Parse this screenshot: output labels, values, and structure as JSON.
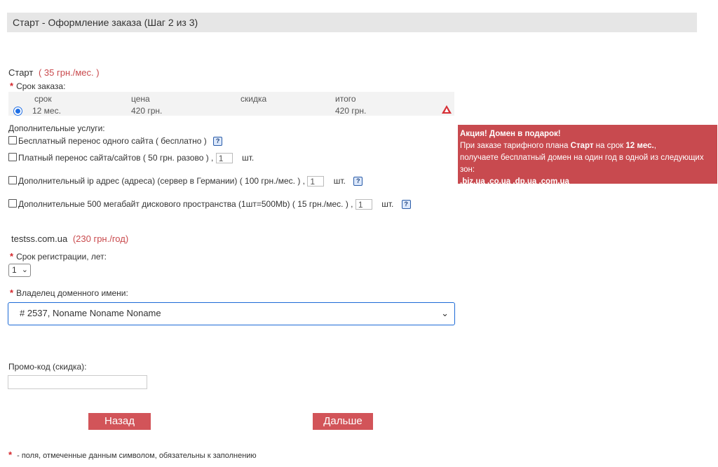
{
  "header": {
    "title": "Старт - Оформление заказа (Шаг 2 из 3)"
  },
  "plan": {
    "name": "Старт",
    "price": "( 35 грн./мес. )",
    "term_label": "Срок заказа:",
    "table": {
      "headers": [
        "срок",
        "цена",
        "скидка",
        "итого"
      ],
      "row": {
        "term": "12 мес.",
        "price": "420 грн.",
        "discount": "",
        "total": "420 грн."
      }
    }
  },
  "extras": {
    "label": "Дополнительные услуги:",
    "items": [
      {
        "text": "Бесплатный перенос одного сайта ( бесплатно )"
      },
      {
        "text": "Платный перенос сайта/сайтов ( 50 грн. разово ) ,",
        "qty": "1",
        "unit": "шт."
      },
      {
        "text": "Дополнительный ip адрес (адреса) (сервер в Германии) ( 100 грн./мес. ) ,",
        "qty": "1",
        "unit": "шт."
      },
      {
        "text": "Дополнительные 500 мегабайт дискового пространства (1шт=500Mb) ( 15 грн./мес. ) ,",
        "qty": "1",
        "unit": "шт."
      }
    ],
    "help_glyph": "?"
  },
  "promo_banner": {
    "title": "Акция! Домен в подарок!",
    "line1_a": "При заказе тарифного плана ",
    "line1_plan": "Старт",
    "line1_b": " на срок ",
    "line1_term": "12 мес.",
    "line1_c": ",",
    "line2": "получаете бесплатный домен на один год в одной из следующих зон:",
    "zones": ".biz.ua .co.ua .dp.ua .com.ua"
  },
  "domain": {
    "name": "testss.com.ua",
    "price": "(230 грн./год)",
    "period_label": "Срок регистрации, лет:",
    "period_value": "1",
    "owner_label": "Владелец доменного имени:",
    "owner_value": "# 2537, Noname Noname Noname"
  },
  "promo_code": {
    "label": "Промо-код (скидка):",
    "value": ""
  },
  "buttons": {
    "back": "Назад",
    "next": "Дальше"
  },
  "footnote": {
    "star": "*",
    "text": " - поля, отмеченные данным символом, обязательны к заполнению"
  },
  "required_star": "*",
  "colors": {
    "accent": "#d25459",
    "banner": "#c84a4f",
    "focus": "#1c6ad6"
  }
}
